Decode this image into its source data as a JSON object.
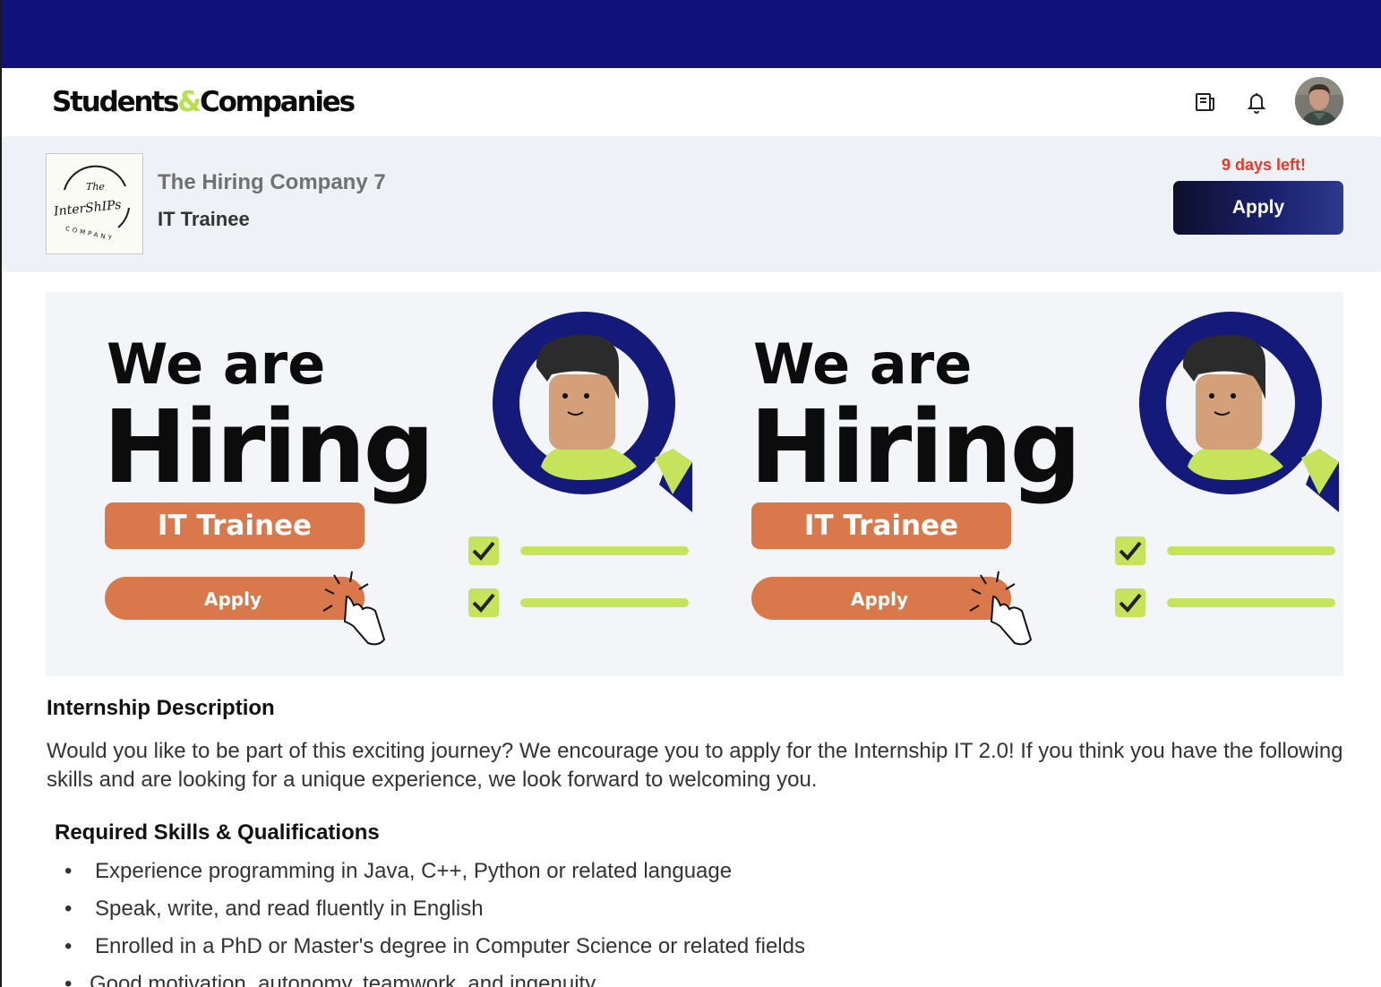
{
  "brand": {
    "logo_left": "Students",
    "logo_amp": "&",
    "logo_right": "Companies",
    "accent": "#b7e04a",
    "topbar_color": "#10127a"
  },
  "nav": {
    "icons": [
      "news-icon",
      "bell-icon"
    ],
    "avatar_icon": "user-avatar"
  },
  "job": {
    "company_name": "The Hiring Company 7",
    "title": "IT Trainee",
    "days_left": "9 days left!",
    "apply_label": "Apply",
    "company_logo": {
      "line1": "The",
      "line2": "InterShIPs",
      "ring_text": "COMPANY"
    }
  },
  "banner": {
    "headline_small": "We are",
    "headline_big": "Hiring",
    "role_tag": "IT Trainee",
    "apply_label": "Apply",
    "colors": {
      "orange": "#d9784a",
      "navy": "#141a7a",
      "green": "#c6e35c",
      "skin": "#d4a07a",
      "hair": "#2b2b2b"
    }
  },
  "description": {
    "heading": "Internship Description",
    "body": "Would you like to be part of this exciting journey? We encourage you to apply for the Internship IT 2.0! If you think you have the following skills and are looking for a unique experience, we look forward to welcoming you."
  },
  "requirements": {
    "heading": "Required Skills & Qualifications",
    "bullet": "•",
    "items": [
      "Experience programming in Java, C++, Python or related language",
      "Speak, write, and read fluently in English",
      "Enrolled in a PhD or Master's degree in Computer Science or related fields",
      "Good motivation, autonomy, teamwork, and ingenuity"
    ]
  }
}
